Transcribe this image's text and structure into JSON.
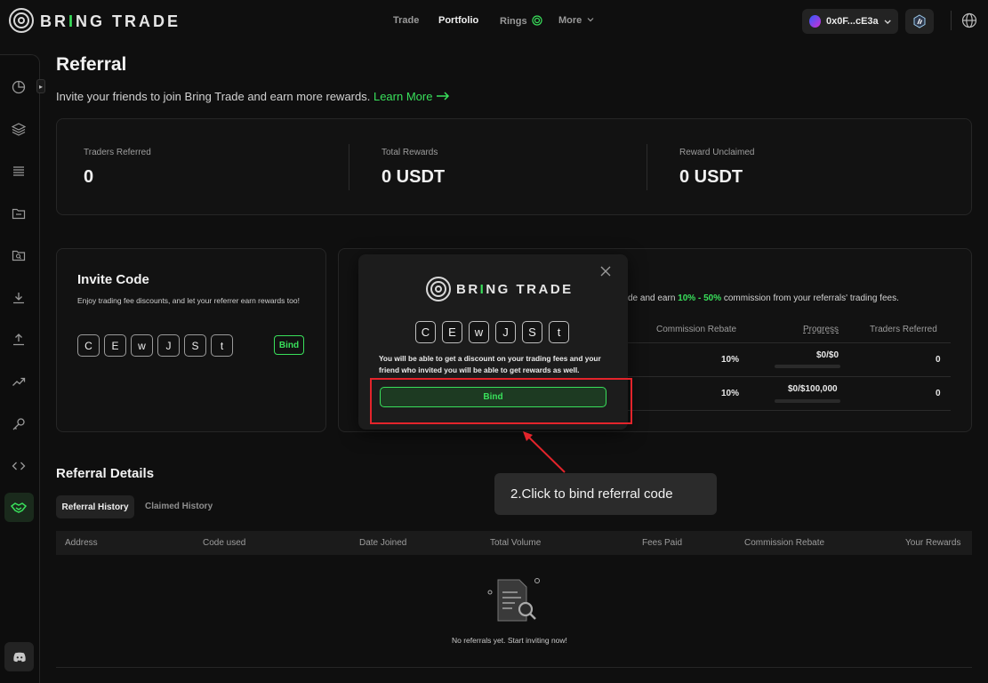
{
  "app": {
    "brand": {
      "text_before": "BR",
      "text_i": "I",
      "text_after": "NG TRADE"
    }
  },
  "nav": {
    "trade": "Trade",
    "portfolio": "Portfolio",
    "rings": "Rings",
    "more": "More"
  },
  "wallet": {
    "address": "0x0F...cE3a"
  },
  "page": {
    "title": "Referral",
    "subtitle": "Invite your friends to join Bring Trade and earn more rewards.",
    "learn_more": "Learn More"
  },
  "stats": [
    {
      "label": "Traders Referred",
      "value": "0"
    },
    {
      "label": "Total Rewards",
      "value": "0 USDT"
    },
    {
      "label": "Reward Unclaimed",
      "value": "0 USDT"
    }
  ],
  "invite": {
    "title": "Invite Code",
    "description": "Enjoy trading fee discounts, and let your referrer earn rewards too!",
    "code_chars": [
      "C",
      "E",
      "w",
      "J",
      "S",
      "t"
    ],
    "bind_label": "Bind"
  },
  "tiers": {
    "intro_visible": "de and earn",
    "intro_pct": "10% - 50%",
    "intro_tail": "commission from your referrals' trading fees.",
    "headers": {
      "rebate": "Commission Rebate",
      "progress": "Progress",
      "traders": "Traders Referred"
    },
    "rows": [
      {
        "rebate": "10%",
        "progress": "$0/$0",
        "progress_fraction": 0,
        "traders": "0"
      },
      {
        "rebate": "10%",
        "progress": "$0/$100,000",
        "progress_fraction": 0,
        "traders": "0"
      }
    ]
  },
  "details": {
    "title": "Referral Details",
    "tabs": [
      "Referral History",
      "Claimed History"
    ],
    "columns": [
      "Address",
      "Code used",
      "Date Joined",
      "Total Volume",
      "Fees Paid",
      "Commission Rebate",
      "Your Rewards"
    ],
    "empty_text": "No referrals yet. Start inviting now!"
  },
  "modal": {
    "code_chars": [
      "C",
      "E",
      "w",
      "J",
      "S",
      "t"
    ],
    "message": "You will be able to get a discount on your trading fees and your friend who invited you will be able to get rewards as well.",
    "bind_label": "Bind"
  },
  "annotation": {
    "tooltip": "2.Click to bind referral code"
  },
  "colors": {
    "accent": "#39e05b",
    "background": "#0f0f0f",
    "highlight": "#e3242b"
  }
}
